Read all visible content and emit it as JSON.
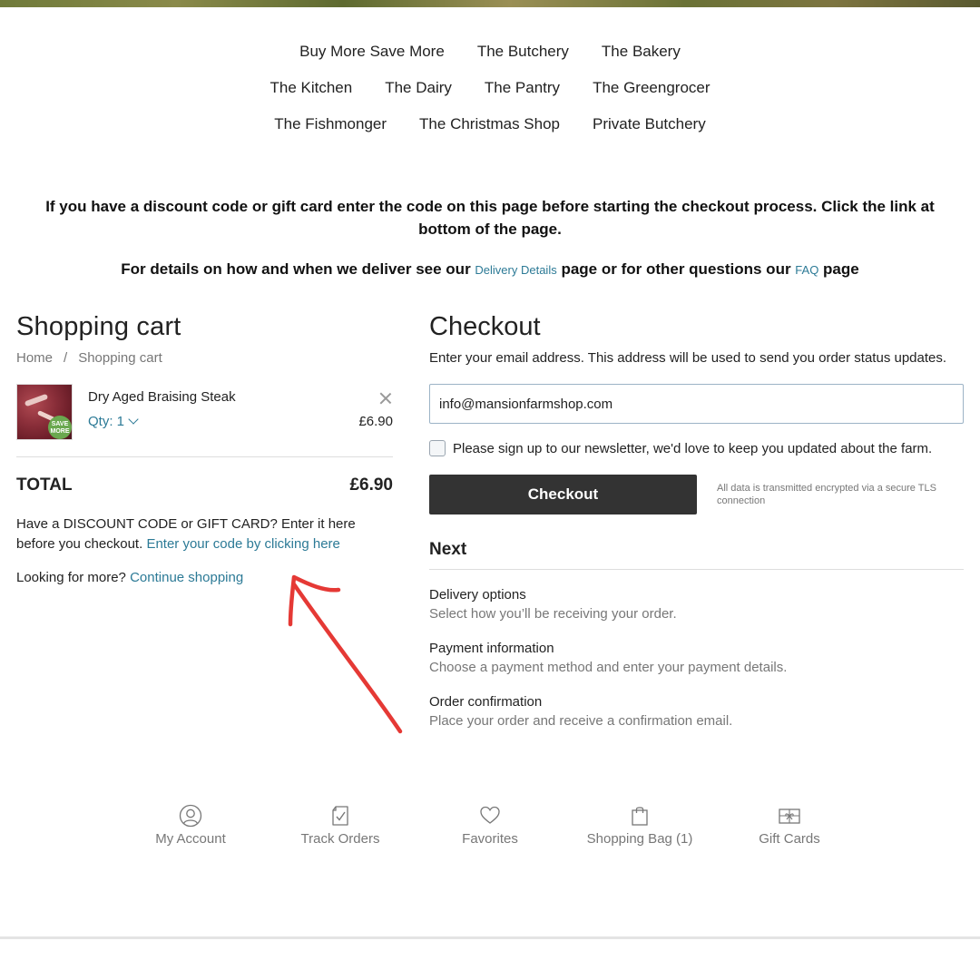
{
  "nav": {
    "row1": [
      "Buy More Save More",
      "The Butchery",
      "The Bakery"
    ],
    "row2": [
      "The Kitchen",
      "The Dairy",
      "The Pantry",
      "The Greengrocer"
    ],
    "row3": [
      "The Fishmonger",
      "The Christmas Shop",
      "Private Butchery"
    ]
  },
  "notice": {
    "discount": "If you have a discount code or gift card enter the code on this page before starting the checkout process. Click the link at bottom of the page.",
    "details_prefix": "For details on how and when we deliver see our ",
    "delivery_link": "Delivery Details",
    "details_middle": " page or for other questions our ",
    "faq_link": "FAQ",
    "details_suffix": " page"
  },
  "cart": {
    "title": "Shopping cart",
    "breadcrumb": [
      "Home",
      "/",
      "Shopping cart"
    ],
    "item": {
      "name": "Dry Aged Braising Steak",
      "qty": "Qty: 1",
      "price": "£6.90",
      "badge": "SAVE MORE"
    },
    "total_label": "TOTAL",
    "total_value": "£6.90",
    "discount_text": "Have a DISCOUNT CODE or GIFT CARD? Enter it here before you checkout. ",
    "discount_link": "Enter your code by clicking here",
    "more_text": "Looking for more? ",
    "more_link": "Continue shopping"
  },
  "checkout": {
    "title": "Checkout",
    "intro": "Enter your email address. This address will be used to send you order status updates.",
    "email_value": "info@mansionfarmshop.com",
    "newsletter": "Please sign up to our newsletter, we'd love to keep you updated about the farm.",
    "button": "Checkout",
    "secure_note": "All data is transmitted encrypted via a secure TLS connection",
    "next_title": "Next",
    "steps": [
      {
        "title": "Delivery options",
        "desc": "Select how you’ll be receiving your order."
      },
      {
        "title": "Payment information",
        "desc": "Choose a payment method and enter your payment details."
      },
      {
        "title": "Order confirmation",
        "desc": "Place your order and receive a confirmation email."
      }
    ]
  },
  "footer_nav": [
    {
      "label": "My Account",
      "icon": "user-icon"
    },
    {
      "label": "Track Orders",
      "icon": "clipboard-check-icon"
    },
    {
      "label": "Favorites",
      "icon": "heart-icon"
    },
    {
      "label": "Shopping Bag (1)",
      "icon": "shopping-bag-icon"
    },
    {
      "label": "Gift Cards",
      "icon": "gift-card-icon"
    }
  ],
  "colors": {
    "link": "#2c7a96",
    "button_bg": "#333333",
    "annotation_arrow": "#e53935"
  }
}
